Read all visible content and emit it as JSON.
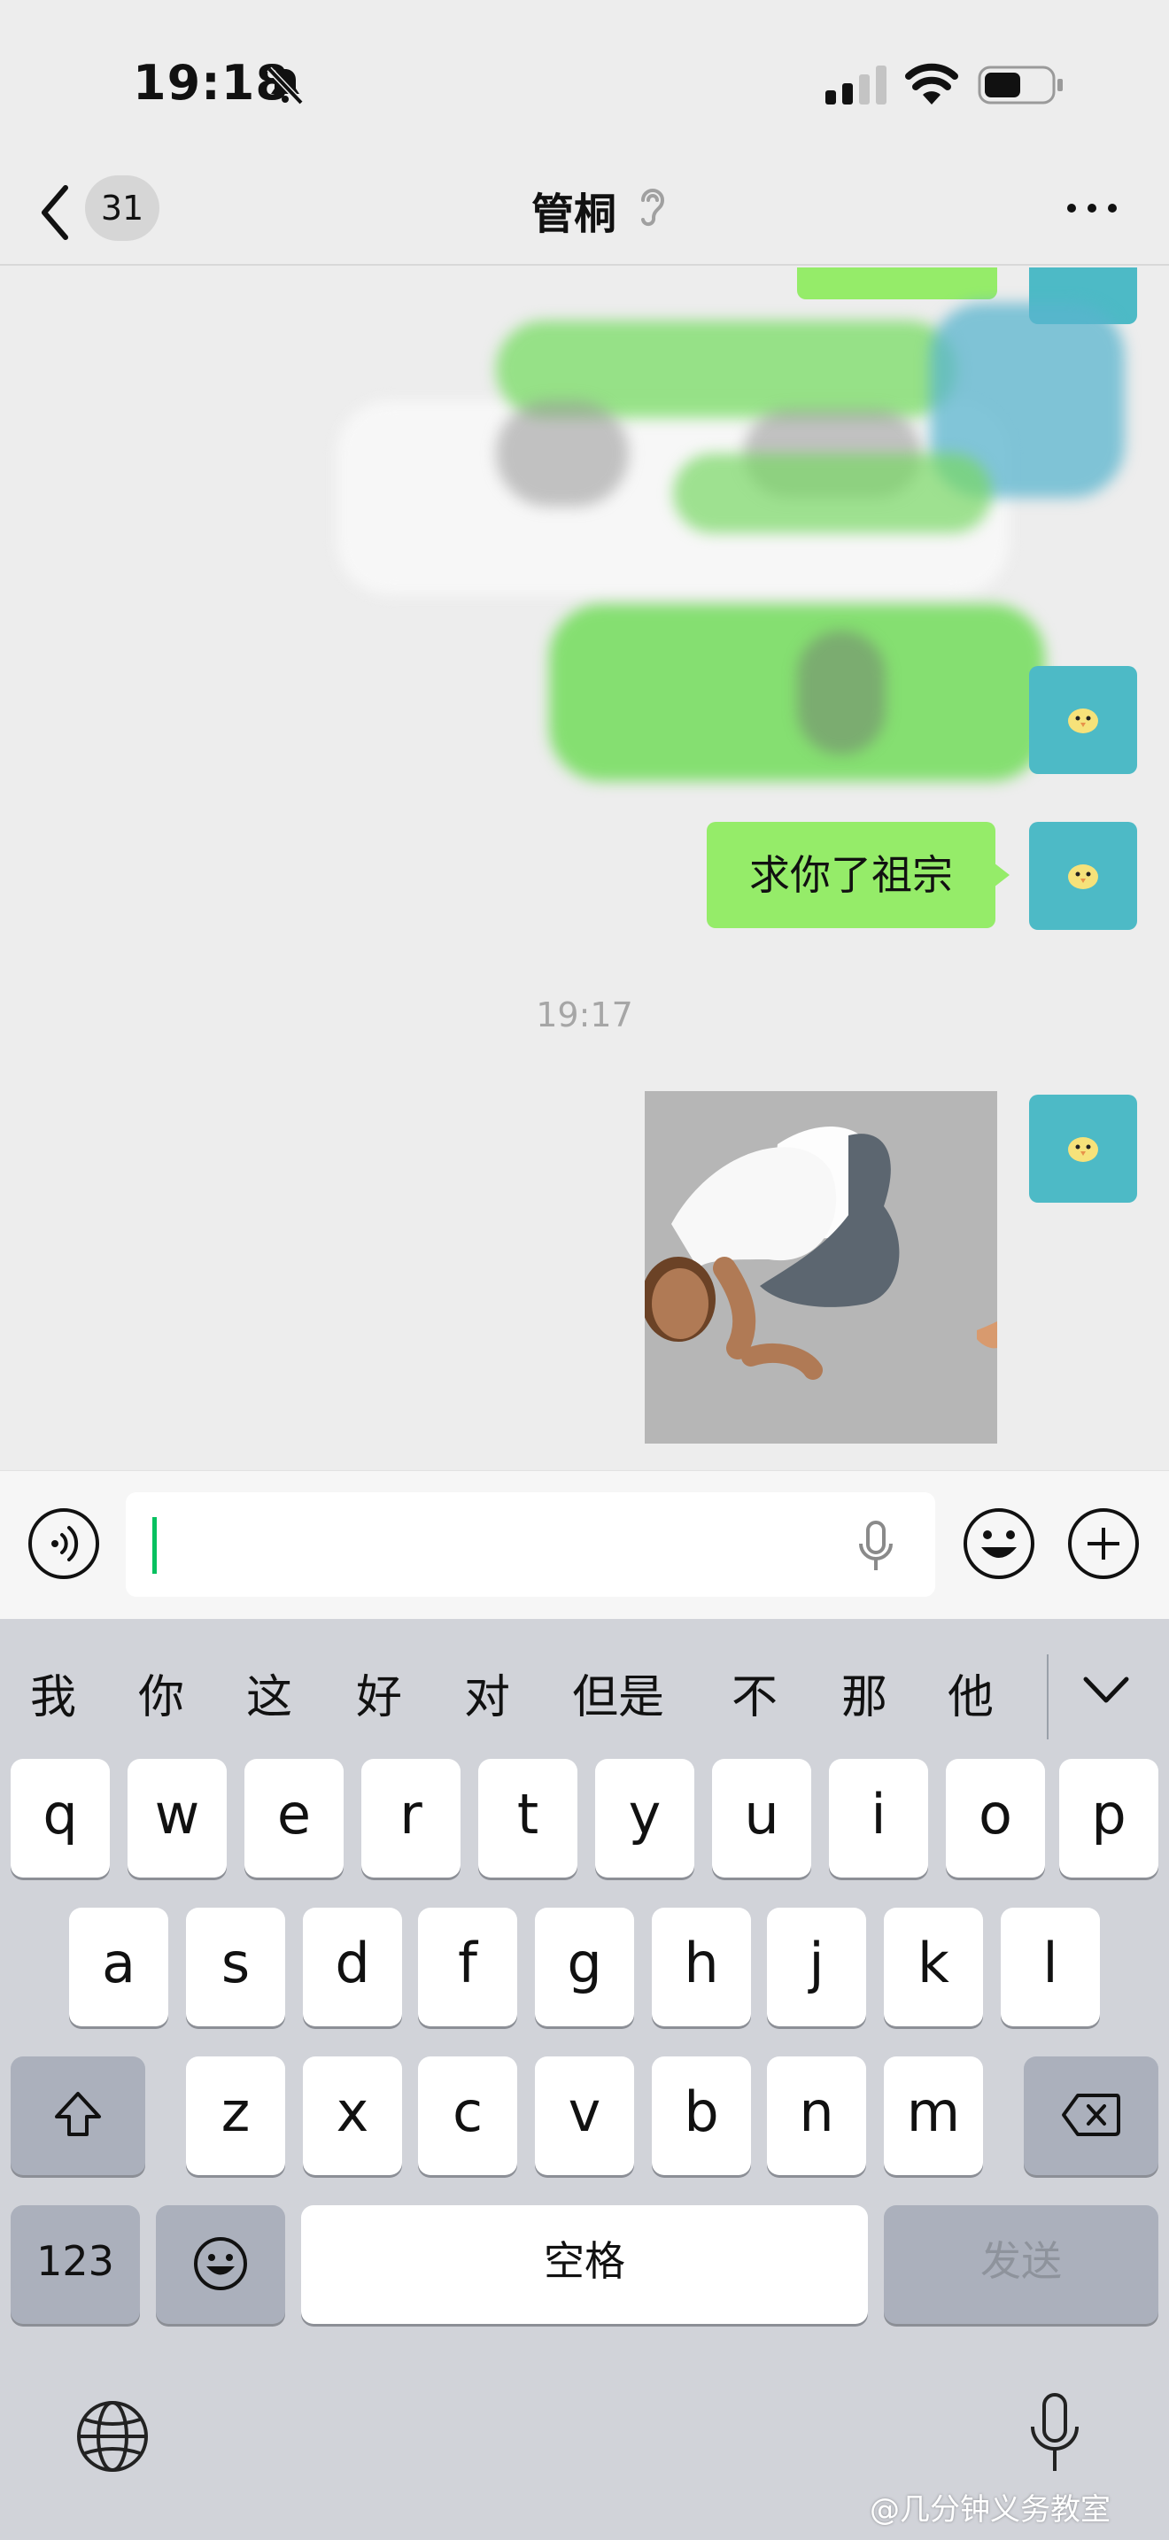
{
  "status_bar": {
    "time": "19:18"
  },
  "nav": {
    "unread_count": "31",
    "title": "管桐"
  },
  "chat": {
    "messages": [
      {
        "text": "求你了祖宗"
      }
    ],
    "time_separator": "19:17"
  },
  "keyboard": {
    "candidates": [
      "我",
      "你",
      "这",
      "好",
      "对",
      "但是",
      "不",
      "那",
      "他"
    ],
    "row1": [
      "q",
      "w",
      "e",
      "r",
      "t",
      "y",
      "u",
      "i",
      "o",
      "p"
    ],
    "row2": [
      "a",
      "s",
      "d",
      "f",
      "g",
      "h",
      "j",
      "k",
      "l"
    ],
    "row3": [
      "z",
      "x",
      "c",
      "v",
      "b",
      "n",
      "m"
    ],
    "numbers_label": "123",
    "space_label": "空格",
    "send_label": "发送"
  },
  "watermark": "@几分钟义务教室",
  "colors": {
    "bubble": "#95ec69",
    "avatar": "#4dbac6",
    "caret": "#07c160"
  }
}
